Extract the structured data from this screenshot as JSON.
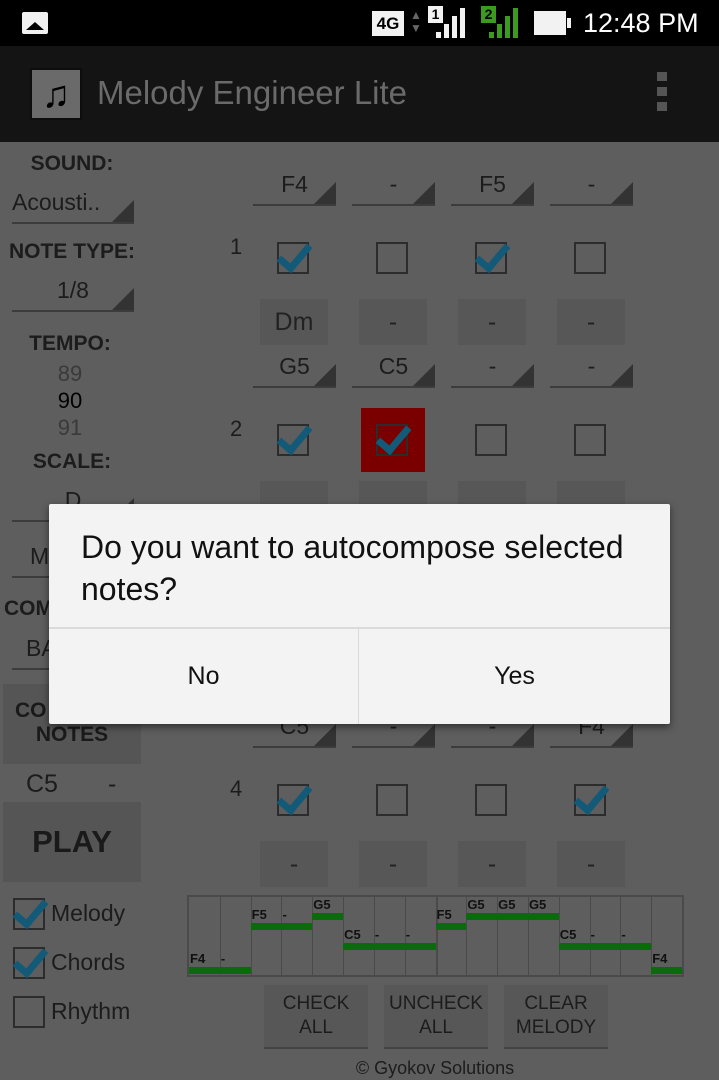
{
  "status_bar": {
    "network": "4G",
    "sim1": "1",
    "sim2": "2",
    "time": "12:48 PM",
    "icons": [
      "image-notification-icon",
      "network-4g-icon",
      "data-arrows-icon",
      "signal-sim1-icon",
      "signal-sim2-icon",
      "battery-icon"
    ],
    "sim2_color": "#3c9a1e"
  },
  "app_bar": {
    "title": "Melody Engineer Lite",
    "icon": "music-note-icon",
    "overflow_icon": "overflow-menu-icon"
  },
  "sidebar": {
    "sound_label": "SOUND:",
    "sound_value": "Acousti..",
    "note_type_label": "NOTE TYPE:",
    "note_type_value": "1/8",
    "tempo_label": "TEMPO:",
    "tempo_prev": "89",
    "tempo_value": "90",
    "tempo_next": "91",
    "scale_label": "SCALE:",
    "scale_value": "D",
    "scale_mode_partial": "M",
    "comp_label_partial": "COM",
    "comp_value_partial": "BA",
    "complete_notes_partial": "CO",
    "complete_notes_label": "NOTES",
    "current_note": "C5",
    "current_chord": "-",
    "play_label": "PLAY",
    "toggles": [
      {
        "label": "Melody",
        "checked": true
      },
      {
        "label": "Chords",
        "checked": true
      },
      {
        "label": "Rhythm",
        "checked": false
      }
    ]
  },
  "measures": [
    {
      "number": "1",
      "notes": [
        "F4",
        "-",
        "F5",
        "-"
      ],
      "checked": [
        true,
        false,
        true,
        false
      ],
      "chords": [
        "Dm",
        "-",
        "-",
        "-"
      ]
    },
    {
      "number": "2",
      "notes": [
        "G5",
        "C5",
        "-",
        "-"
      ],
      "checked": [
        true,
        true,
        false,
        false
      ],
      "highlighted": [
        false,
        true,
        false,
        false
      ],
      "chords": [
        "-",
        "-",
        "-",
        "-"
      ]
    },
    {
      "number": "4",
      "notes": [
        "C5",
        "-",
        "-",
        "F4"
      ],
      "checked": [
        true,
        false,
        false,
        true
      ],
      "chords": [
        "-",
        "-",
        "-",
        "-"
      ]
    }
  ],
  "highlight_color": "#7a0000",
  "check_color": "#125a78",
  "piano_roll": {
    "notes": [
      "F4",
      "-",
      "F5",
      "-",
      "G5",
      "C5",
      "-",
      "-",
      "F5",
      "G5",
      "G5",
      "G5",
      "C5",
      "-",
      "-",
      "F4"
    ],
    "bar_color": "#0b6a0b"
  },
  "bottom_buttons": [
    {
      "line1": "CHECK",
      "line2": "ALL"
    },
    {
      "line1": "UNCHECK",
      "line2": "ALL"
    },
    {
      "line1": "CLEAR",
      "line2": "MELODY"
    }
  ],
  "footer": "© Gyokov Solutions",
  "dialog": {
    "message": "Do you want to autocompose selected notes?",
    "no_label": "No",
    "yes_label": "Yes"
  }
}
